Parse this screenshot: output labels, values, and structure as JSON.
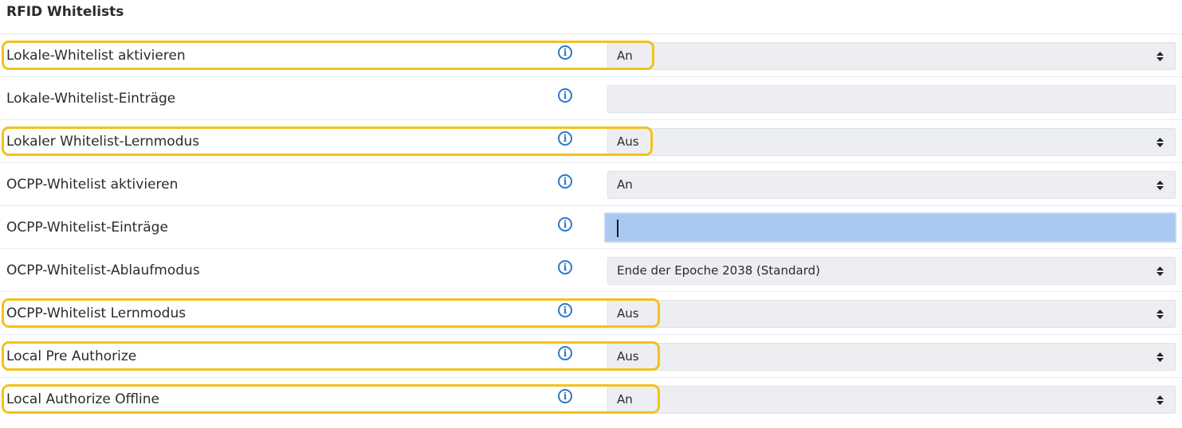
{
  "section": {
    "title": "RFID Whitelists"
  },
  "rows": [
    {
      "label": "Lokale-Whitelist aktivieren",
      "value": "An",
      "type": "select",
      "highlighted": true
    },
    {
      "label": "Lokale-Whitelist-Einträge",
      "value": "",
      "type": "text",
      "highlighted": false
    },
    {
      "label": "Lokaler Whitelist-Lernmodus",
      "value": "Aus",
      "type": "select",
      "highlighted": true
    },
    {
      "label": "OCPP-Whitelist aktivieren",
      "value": "An",
      "type": "select",
      "highlighted": false
    },
    {
      "label": "OCPP-Whitelist-Einträge",
      "value": "",
      "type": "text-focused",
      "highlighted": false
    },
    {
      "label": "OCPP-Whitelist-Ablaufmodus",
      "value": "Ende der Epoche 2038 (Standard)",
      "type": "select",
      "highlighted": false
    },
    {
      "label": "OCPP-Whitelist Lernmodus",
      "value": "Aus",
      "type": "select",
      "highlighted": true
    },
    {
      "label": "Local Pre Authorize",
      "value": "Aus",
      "type": "select",
      "highlighted": true
    },
    {
      "label": "Local Authorize Offline",
      "value": "An",
      "type": "select",
      "highlighted": true
    }
  ],
  "icons": {
    "info": "info-circle-icon",
    "select": "sort-arrows-icon"
  },
  "colors": {
    "highlight": "#f2c21a",
    "info": "#2e78c9",
    "field_background": "#eceef1",
    "focused_field_background": "#a9c8f0"
  }
}
